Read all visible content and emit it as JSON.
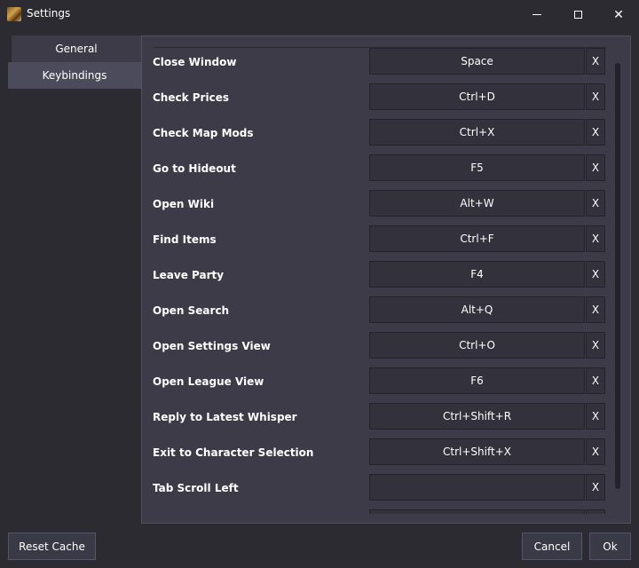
{
  "window": {
    "title": "Settings"
  },
  "sidebar": {
    "tabs": [
      {
        "label": "General"
      },
      {
        "label": "Keybindings"
      }
    ],
    "active": "Keybindings"
  },
  "keybindings": [
    {
      "action": "Close Window",
      "key": "Space",
      "clear": "X"
    },
    {
      "action": "Check Prices",
      "key": "Ctrl+D",
      "clear": "X"
    },
    {
      "action": "Check Map Mods",
      "key": "Ctrl+X",
      "clear": "X"
    },
    {
      "action": "Go to Hideout",
      "key": "F5",
      "clear": "X"
    },
    {
      "action": "Open Wiki",
      "key": "Alt+W",
      "clear": "X"
    },
    {
      "action": "Find Items",
      "key": "Ctrl+F",
      "clear": "X"
    },
    {
      "action": "Leave Party",
      "key": "F4",
      "clear": "X"
    },
    {
      "action": "Open Search",
      "key": "Alt+Q",
      "clear": "X"
    },
    {
      "action": "Open Settings View",
      "key": "Ctrl+O",
      "clear": "X"
    },
    {
      "action": "Open League View",
      "key": "F6",
      "clear": "X"
    },
    {
      "action": "Reply to Latest Whisper",
      "key": "Ctrl+Shift+R",
      "clear": "X"
    },
    {
      "action": "Exit to Character Selection",
      "key": "Ctrl+Shift+X",
      "clear": "X"
    },
    {
      "action": "Tab Scroll Left",
      "key": "",
      "clear": "X"
    },
    {
      "action": "",
      "key": "",
      "clear": ""
    }
  ],
  "footer": {
    "reset_label": "Reset Cache",
    "cancel_label": "Cancel",
    "ok_label": "Ok"
  },
  "colors": {
    "background": "#2c2b32",
    "panel": "#3c3b47",
    "active_tab": "#4c4b5b",
    "field": "#32313c"
  }
}
